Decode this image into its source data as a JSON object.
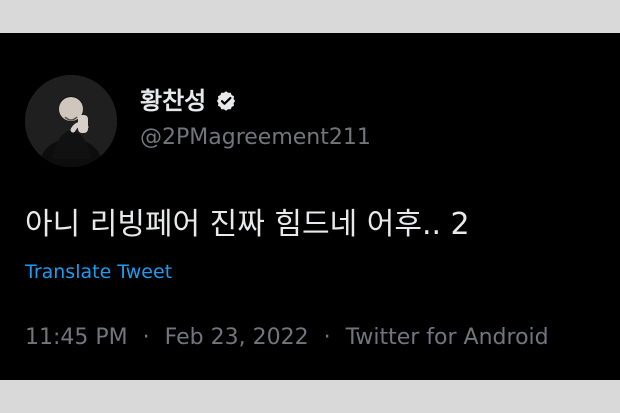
{
  "tweet": {
    "author": {
      "display_name": "황찬성",
      "handle": "@2PMagreement211",
      "verified": true
    },
    "text": "아니 리빙페어 진짜 힘드네 어후.. 2",
    "translate_label": "Translate Tweet",
    "meta": {
      "time": "11:45 PM",
      "separator": "·",
      "date": "Feb 23, 2022",
      "source": "Twitter for Android"
    }
  },
  "colors": {
    "background": "#000000",
    "primary_text": "#e7e9ea",
    "secondary_text": "#71767b",
    "link": "#1d9bf0"
  },
  "icons": {
    "verified": "verified-badge-icon",
    "avatar": "profile-photo"
  }
}
